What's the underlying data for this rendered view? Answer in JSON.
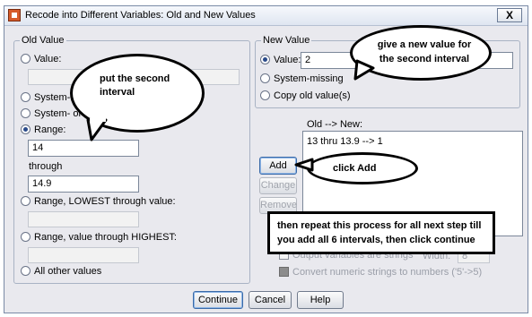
{
  "window": {
    "title": "Recode into Different Variables: Old and New Values",
    "close_label": "X"
  },
  "old_value": {
    "legend": "Old Value",
    "value_label": "Value:",
    "value_field": "",
    "system_missing_label": "System-missing",
    "system_or_user_missing_label": "System- or user-missing",
    "range_label": "Range:",
    "range_from": "14",
    "through_label": "through",
    "range_to": "14.9",
    "range_lowest_label": "Range, LOWEST through value:",
    "range_lowest_field": "",
    "range_highest_label": "Range, value through HIGHEST:",
    "range_highest_field": "",
    "all_other_label": "All other values",
    "selected": "range"
  },
  "new_value": {
    "legend": "New Value",
    "value_label": "Value:",
    "value_field": "2",
    "system_missing_label": "System-missing",
    "copy_old_label": "Copy old value(s)",
    "selected": "value"
  },
  "old_new": {
    "label": "Old --> New:",
    "items": [
      "13 thru 13.9 --> 1"
    ]
  },
  "actions": {
    "add": "Add",
    "change": "Change",
    "remove": "Remove"
  },
  "options": {
    "output_strings_label": "Output variables are strings",
    "width_label": "Width:",
    "width_value": "8",
    "convert_label": "Convert numeric strings to numbers ('5'->5)"
  },
  "footer": {
    "continue": "Continue",
    "cancel": "Cancel",
    "help": "Help"
  },
  "annotations": {
    "bubble_interval": "put the second interval",
    "bubble_new_value": "give a new value for the second interval",
    "bubble_add": "click Add",
    "note_repeat": "then repeat this process for all next step till you add all  6 intervals, then click continue"
  }
}
